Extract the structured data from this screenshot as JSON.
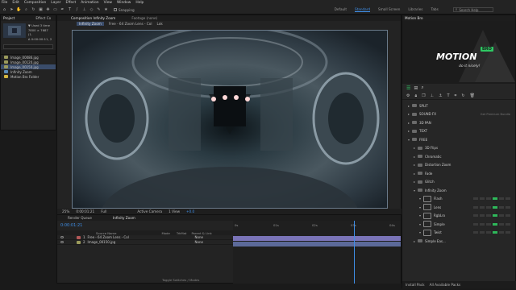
{
  "menu": [
    "File",
    "Edit",
    "Composition",
    "Layer",
    "Effect",
    "Animation",
    "View",
    "Window",
    "Help"
  ],
  "toolbar": {
    "snapping": "Snapping",
    "workspaces": [
      "Default",
      "Standard",
      "Small Screen",
      "Libraries",
      "Tabs"
    ],
    "active_workspace": "Standard",
    "search_placeholder": "Search Help"
  },
  "project": {
    "title": "Project",
    "effect_controls": "Effect Co",
    "info_lines": [
      "▼ Used 3 time",
      "7800 × 7687 (1.",
      "Δ 0:00:00:11, 2"
    ],
    "items": [
      {
        "name": "Image_00086.jpg",
        "color": "#9b9b5c",
        "sel": false
      },
      {
        "name": "Image_00120.jpg",
        "color": "#9b9b5c",
        "sel": false
      },
      {
        "name": "Image_00150.jpg",
        "color": "#9b9b5c",
        "sel": true
      },
      {
        "name": "Infinity Zoom",
        "color": "#5a8ab8",
        "sel": false
      },
      {
        "name": "Motion Bro Folder",
        "color": "#d4b640",
        "sel": false
      }
    ]
  },
  "preview": {
    "title": "Preview"
  },
  "composition": {
    "tab": "Composition Infinity Zoom",
    "footage_tab": "Footage (none)",
    "breadcrumbs": [
      "Infinity Zoom",
      "Free - 64 Zoom Lens - Col",
      "Lok"
    ],
    "footer": {
      "zoom": "25%",
      "timecode": "0:00:01:21",
      "resolution": "Full",
      "camera": "Active Camera",
      "views": "1 View",
      "offset": "+0.0"
    }
  },
  "timeline": {
    "tabs": [
      "Render Queue",
      "Infinity Zoom"
    ],
    "timecode": "0:00:01:21",
    "columns": {
      "source": "Source Name",
      "mode": "Mode",
      "track": "TrkMat",
      "parent": "Parent & Link"
    },
    "layers": [
      {
        "num": "1",
        "name": "Free - 64 Zoom Lens - Col",
        "mode": "None",
        "color": "#b25858"
      },
      {
        "num": "2",
        "name": "Image_00150.jpg",
        "mode": "None",
        "color": "#9b9b5c"
      }
    ],
    "ruler": [
      "0s",
      "01s",
      "02s",
      "03s",
      "04s"
    ],
    "footer": "Toggle Switches / Modes"
  },
  "motionbro": {
    "panel_title": "Motion Bro",
    "logo_main": "MOTION",
    "logo_badge": "BRO",
    "logo_sub": "do it nicely!",
    "tree": [
      {
        "label": "SPLIT",
        "depth": 0,
        "open": false
      },
      {
        "label": "SOUND FX",
        "depth": 0,
        "open": false,
        "badge": "Get Premium Bundle"
      },
      {
        "label": "3D PAN",
        "depth": 0,
        "open": false
      },
      {
        "label": "TEXT",
        "depth": 0,
        "open": false
      },
      {
        "label": "FREE",
        "depth": 0,
        "open": true
      },
      {
        "label": "3D Flips",
        "depth": 1,
        "open": false
      },
      {
        "label": "Chromatic",
        "depth": 1,
        "open": false
      },
      {
        "label": "Distortion Zoom",
        "depth": 1,
        "open": false
      },
      {
        "label": "Fade",
        "depth": 1,
        "open": false
      },
      {
        "label": "Glitch",
        "depth": 1,
        "open": false
      },
      {
        "label": "Infinity Zoom",
        "depth": 1,
        "open": true
      },
      {
        "label": "Flash",
        "depth": 2,
        "open": true,
        "icon": true
      },
      {
        "label": "Lens",
        "depth": 2,
        "open": true,
        "icon": true
      },
      {
        "label": "RgbLro",
        "depth": 2,
        "open": true,
        "icon": true
      },
      {
        "label": "Simple",
        "depth": 2,
        "open": true,
        "icon": true
      },
      {
        "label": "Twist",
        "depth": 2,
        "open": true,
        "icon": true
      },
      {
        "label": "Simple Eas...",
        "depth": 1,
        "open": false
      }
    ],
    "footer": [
      "Install Pack",
      "All Available Packs"
    ]
  }
}
